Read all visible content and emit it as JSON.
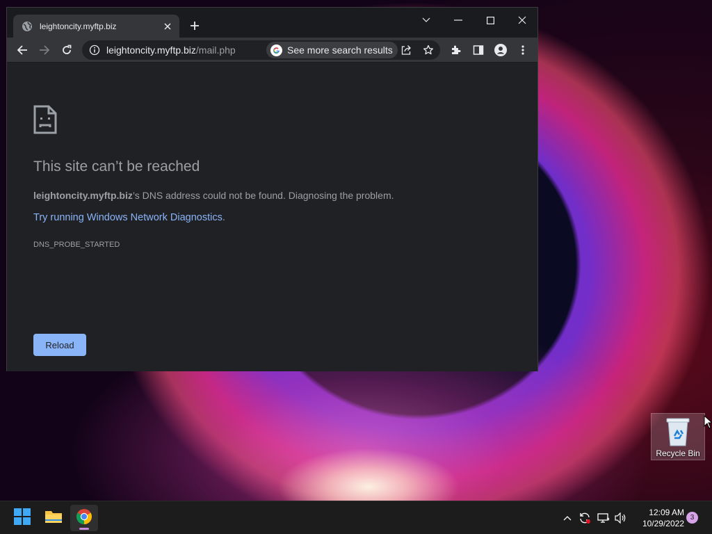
{
  "browser": {
    "tab": {
      "title": "leightoncity.myftp.biz",
      "favicon": "globe-icon",
      "close_icon": "close-icon"
    },
    "new_tab_icon": "plus-icon",
    "window_controls": [
      "chevron-down-icon",
      "minimize-icon",
      "maximize-icon",
      "close-icon"
    ],
    "toolbar": {
      "back_icon": "back-arrow-icon",
      "forward_icon": "forward-arrow-icon",
      "reload_icon": "reload-icon",
      "address": {
        "host": "leightoncity.myftp.biz",
        "path": "/mail.php",
        "info_icon": "info-icon"
      },
      "search_chip": {
        "label": "See more search results",
        "icon": "google-icon"
      },
      "share_icon": "share-icon",
      "bookmark_icon": "star-icon",
      "extensions_icon": "puzzle-icon",
      "side_panel_icon": "side-panel-icon",
      "profile_icon": "person-icon",
      "menu_icon": "kebab-menu-icon"
    },
    "error_page": {
      "icon": "sad-file-icon",
      "title": "This site can’t be reached",
      "desc_host": "leightoncity.myftp.biz",
      "desc_rest": "’s DNS address could not be found. Diagnosing the problem.",
      "link_text": "Try running Windows Network Diagnostics",
      "link_suffix": ".",
      "code": "DNS_PROBE_STARTED",
      "reload_label": "Reload",
      "accent": "#8ab4f8"
    }
  },
  "desktop": {
    "recycle_bin": {
      "label": "Recycle Bin",
      "icon": "recycle-bin-icon"
    }
  },
  "taskbar": {
    "apps": [
      {
        "name": "start",
        "icon": "windows-logo-icon"
      },
      {
        "name": "file-explorer",
        "icon": "folder-icon"
      },
      {
        "name": "chrome",
        "icon": "chrome-icon",
        "active": true
      }
    ],
    "tray": [
      "chevron-up-icon",
      "sync-icon",
      "network-icon",
      "volume-icon"
    ],
    "clock": {
      "time": "12:09 AM",
      "date": "10/29/2022"
    },
    "notification_count": "3"
  }
}
